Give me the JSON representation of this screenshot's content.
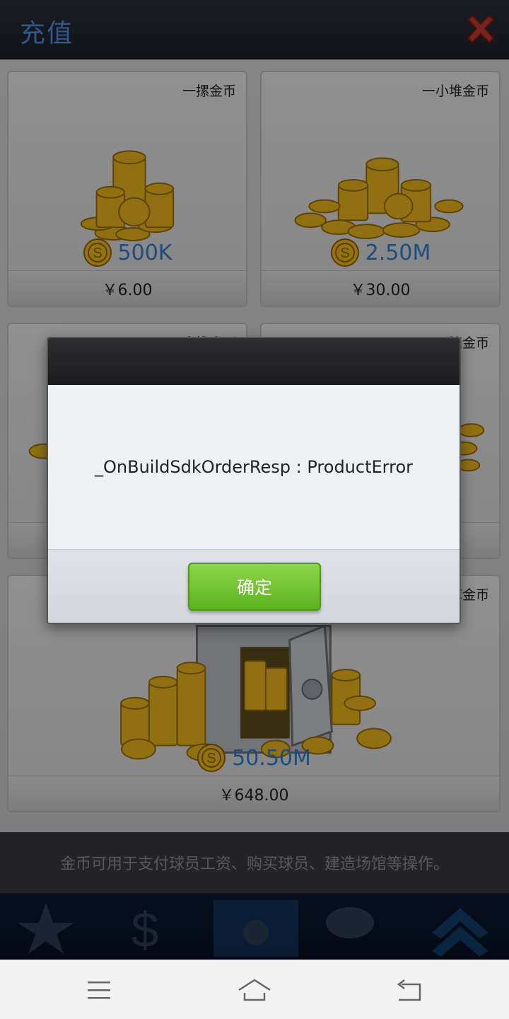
{
  "header": {
    "title": "充值",
    "close_icon": "close-icon"
  },
  "products": [
    {
      "name": "一摞金币",
      "amount": "500K",
      "price": "￥6.00"
    },
    {
      "name": "一小堆金币",
      "amount": "2.50M",
      "price": "￥30.00"
    },
    {
      "name": "一大堆金币",
      "amount": "",
      "price": ""
    },
    {
      "name": "一箱金币",
      "amount": "",
      "price": ""
    },
    {
      "name": "一保险库金币",
      "amount": "50.50M",
      "price": "￥648.00"
    }
  ],
  "footer": {
    "note": "金币可用于支付球员工资、购买球员、建造场馆等操作。"
  },
  "dialog": {
    "message": "_OnBuildSdkOrderResp : ProductError",
    "ok_label": "确定"
  },
  "nav": {
    "menu_icon": "menu-icon",
    "home_icon": "home-icon",
    "back_icon": "back-icon"
  },
  "colors": {
    "accent": "#4f8fe0",
    "amount": "#2f7bd0",
    "ok_button": "#6cc02f",
    "close": "#c0392b"
  }
}
